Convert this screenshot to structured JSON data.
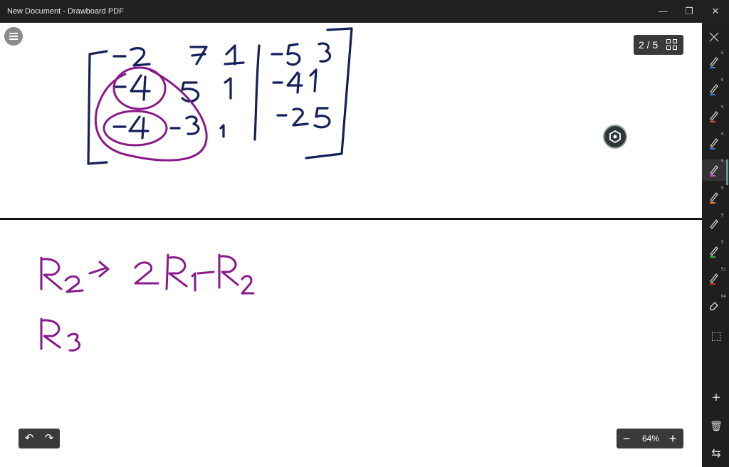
{
  "window": {
    "title": "New Document - Drawboard PDF",
    "minimize_glyph": "—",
    "restore_glyph": "❐",
    "close_glyph": "✕"
  },
  "page_indicator": {
    "text": "2 / 5"
  },
  "zoom": {
    "value": "64%",
    "minus": "−",
    "plus": "+"
  },
  "history": {
    "undo_glyph": "↶",
    "redo_glyph": "↷"
  },
  "toolbar": {
    "tools": [
      {
        "name": "pen-tool-1",
        "color": "#4a78c8",
        "badge": "5"
      },
      {
        "name": "pen-tool-2",
        "color": "#2f7fd6",
        "badge": "5"
      },
      {
        "name": "pen-tool-3",
        "color": "#d44a4a",
        "badge": "5"
      },
      {
        "name": "pen-tool-4",
        "color": "#2f7fd6",
        "badge": "5"
      },
      {
        "name": "pen-tool-5",
        "color": "#c050c0",
        "badge": "5"
      },
      {
        "name": "pen-tool-6",
        "color": "#e07a2a",
        "badge": "5"
      },
      {
        "name": "pen-tool-7",
        "color": "#222222",
        "badge": "5"
      },
      {
        "name": "pen-tool-8",
        "color": "#2bb04a",
        "badge": "5"
      },
      {
        "name": "highlighter-tool",
        "color": "#d42a2a",
        "badge": "51"
      },
      {
        "name": "eraser-tool",
        "color": "#bbbbbb",
        "badge": "64"
      }
    ],
    "add_glyph": "+",
    "delete_glyph": "🗑",
    "swap_glyph": "⇆",
    "select_glyph": "⬚"
  },
  "colors": {
    "ink_blue": "#14205a",
    "ink_purple": "#8a1a8a",
    "accent": "#6a8f8f"
  }
}
